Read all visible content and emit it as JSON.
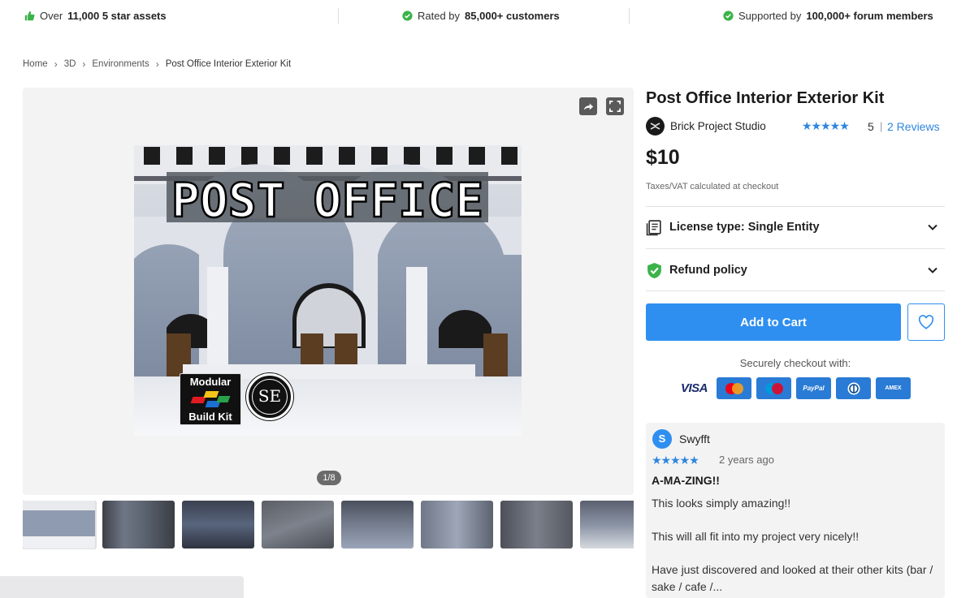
{
  "trust_bar": {
    "item1_prefix": "Over",
    "item1_bold": "11,000 5 star assets",
    "item2_prefix": "Rated by",
    "item2_bold": "85,000+ customers",
    "item3_prefix": "Supported by",
    "item3_bold": "100,000+ forum members",
    "accent": "#3cb34a"
  },
  "breadcrumb": [
    "Home",
    "3D",
    "Environments",
    "Post Office Interior Exterior Kit"
  ],
  "gallery": {
    "counter": "1/8",
    "main_image_text": "POST OFFICE",
    "badge_modular_top": "Modular",
    "badge_modular_bottom": "Build Kit",
    "badge_se": "SE",
    "thumbnails": [
      "thumb-1",
      "thumb-2",
      "thumb-3",
      "thumb-4",
      "thumb-5",
      "thumb-6",
      "thumb-7",
      "thumb-8"
    ]
  },
  "product": {
    "title": "Post Office Interior Exterior Kit",
    "publisher": "Brick Project Studio",
    "stars": "★★★★★",
    "rating": "5",
    "reviews_link": "2 Reviews",
    "price": "$10",
    "tax_note": "Taxes/VAT calculated at checkout",
    "license_label": "License type: Single Entity",
    "refund_label": "Refund policy",
    "add_to_cart": "Add to Cart",
    "secure_label": "Securely checkout with:",
    "accent_color": "#2e8ff0"
  },
  "payments": {
    "visa": "VISA",
    "mastercard": "mastercard",
    "maestro": "maestro",
    "paypal": "PayPal",
    "diners": "Diners",
    "amex": "AMEX"
  },
  "review": {
    "avatar_letter": "S",
    "author": "Swyfft",
    "stars": "★★★★★",
    "date": "2 years ago",
    "title": "A-MA-ZING!!",
    "paragraphs": [
      "This looks simply amazing!!",
      "This will all fit into my project very nicely!!",
      "Have just discovered and looked at their other kits (bar / sake / cafe /..."
    ]
  }
}
